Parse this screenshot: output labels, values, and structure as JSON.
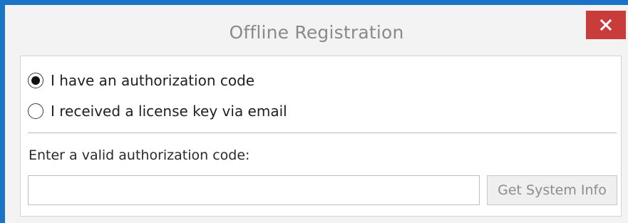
{
  "window": {
    "title": "Offline Registration",
    "close_icon": "close-icon",
    "colors": {
      "frame_border": "#1a73c4",
      "close_button": "#c83c3c",
      "title_text": "#8a8a8a"
    }
  },
  "options": [
    {
      "label": "I have an authorization code",
      "selected": true
    },
    {
      "label": "I received a license key via email",
      "selected": false
    }
  ],
  "code_field": {
    "label": "Enter a valid authorization code:",
    "value": "",
    "placeholder": ""
  },
  "buttons": {
    "system_info": "Get System Info"
  }
}
